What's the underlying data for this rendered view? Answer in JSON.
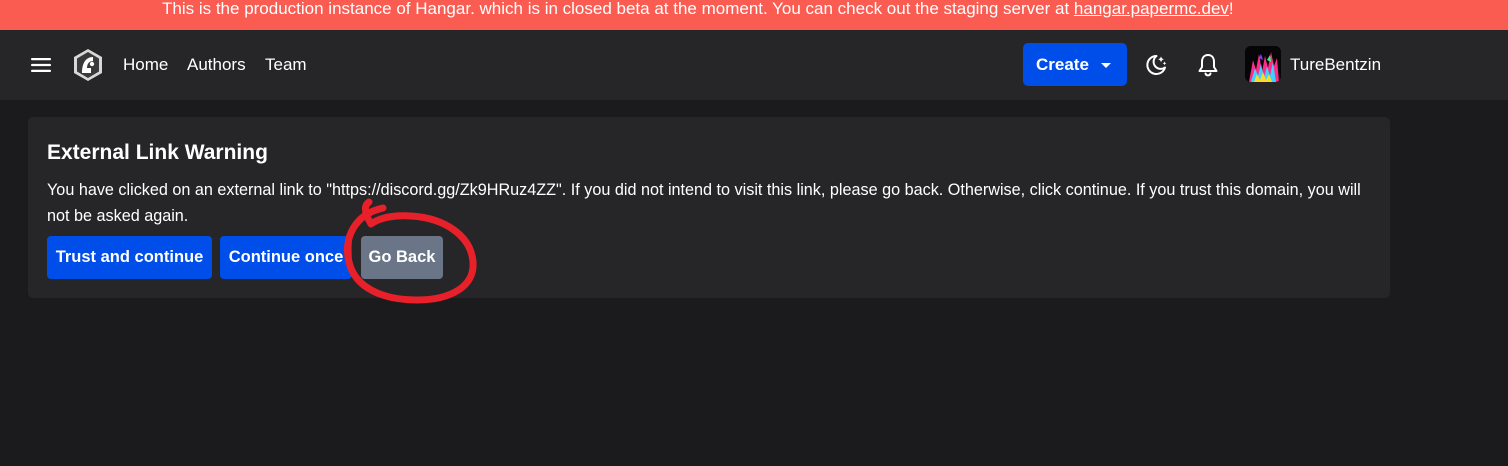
{
  "banner": {
    "text": "This is the production instance of Hangar. which is in closed beta at the moment. You can check out the staging server at ",
    "link": "hangar.papermc.dev",
    "suffix": "!",
    "color": "#fa5c52"
  },
  "header": {
    "nav": [
      "Home",
      "Authors",
      "Team"
    ],
    "create_label": "Create",
    "username": "TureBentzin",
    "icons": {
      "menu": "hamburger-menu-icon",
      "logo": "hangar-logo-icon",
      "theme": "moon-stars-icon",
      "notifications": "bell-icon",
      "create_dropdown": "caret-down-icon"
    },
    "accent": "#004ee9"
  },
  "warning": {
    "title": "External Link Warning",
    "message": "You have clicked on an external link to \"https://discord.gg/Zk9HRuz4ZZ\". If you did not intend to visit this link, please go back. Otherwise, click continue. If you trust this domain, you will not be asked again.",
    "buttons": {
      "trust": "Trust and continue",
      "once": "Continue once",
      "back": "Go Back"
    }
  },
  "annotation": {
    "color": "#e8202a",
    "shape": "hand-drawn-circle"
  }
}
